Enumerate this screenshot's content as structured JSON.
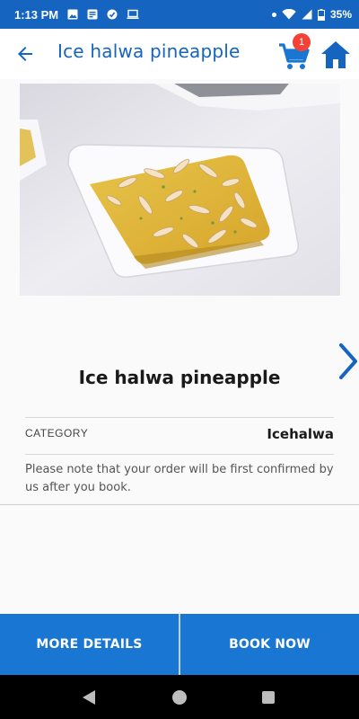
{
  "status_bar": {
    "time": "1:13 PM",
    "battery": "35%",
    "icons": [
      "gallery-icon",
      "news-icon",
      "sync-icon",
      "laptop-icon",
      "dot-icon",
      "wifi-icon",
      "signal-icon",
      "battery-icon"
    ]
  },
  "app_bar": {
    "title": "Ice halwa pineapple",
    "cart_count": "1",
    "accent_color": "#1565c0"
  },
  "product": {
    "name": "Ice halwa pineapple",
    "category_label": "CATEGORY",
    "category_value": "Icehalwa",
    "note": "Please note that your order will be first confirmed by us after you book."
  },
  "actions": {
    "more_details": "MORE DETAILS",
    "book_now": "BOOK NOW",
    "button_color": "#1976d2"
  }
}
